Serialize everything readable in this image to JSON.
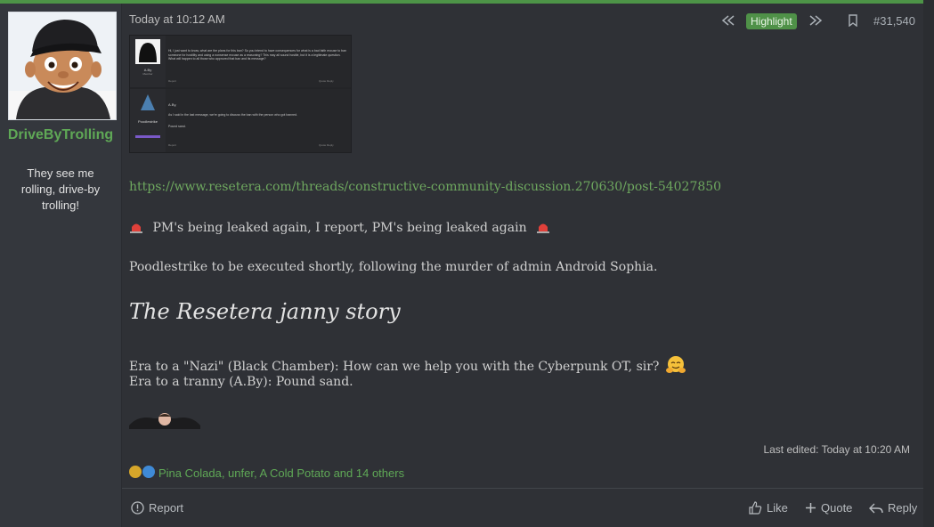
{
  "user": {
    "name": "DriveByTrolling",
    "title": "They see me rolling, drive-by trolling!"
  },
  "post": {
    "timestamp": "Today at 10:12 AM",
    "highlight_label": "Highlight",
    "post_number": "#31,540",
    "link": "https://www.resetera.com/threads/constructive-community-discussion.270630/post-54027850",
    "line1": "PM's being leaked again, I report, PM's being leaked again",
    "line2": "Poodlestrike to be executed shortly, following the murder of admin Android Sophia.",
    "heading": "The Resetera janny story",
    "line3": "Era to a \"Nazi\" (Black Chamber): How can we help you with the Cyberpunk OT, sir?",
    "line4": "Era to a tranny (A.By): Pound sand.",
    "last_edited": "Last edited: Today at 10:20 AM",
    "reactions_text": "Pina Colada, unfer, A Cold Potato and 14 others"
  },
  "embedded_screenshot": {
    "user1": "A.By",
    "user1_role": "Member",
    "text1": "Hi, I just want to know, what are the plans for this ban? So you intend to have consequences for what is a bad faith excuse to ban someone for hostility and using a nonsense excuse as a reasoning? This may all sound hostile, but it is a legitimate question. What will happen to all those who approved that ban and its message?",
    "user2": "Poodlestrike",
    "text2a": "A.By,",
    "text2b": "As I said in the last message, we're going to discuss the ban with the person who got banned.",
    "text2c": "Pound sand.",
    "actions": "Report",
    "reply": "Quote   Reply"
  },
  "footer": {
    "report": "Report",
    "like": "Like",
    "quote": "Quote",
    "reply": "Reply"
  },
  "colors": {
    "accent": "#4f9148",
    "link": "#6ea85f",
    "background": "#2f3136",
    "sidebar": "#34373d"
  }
}
